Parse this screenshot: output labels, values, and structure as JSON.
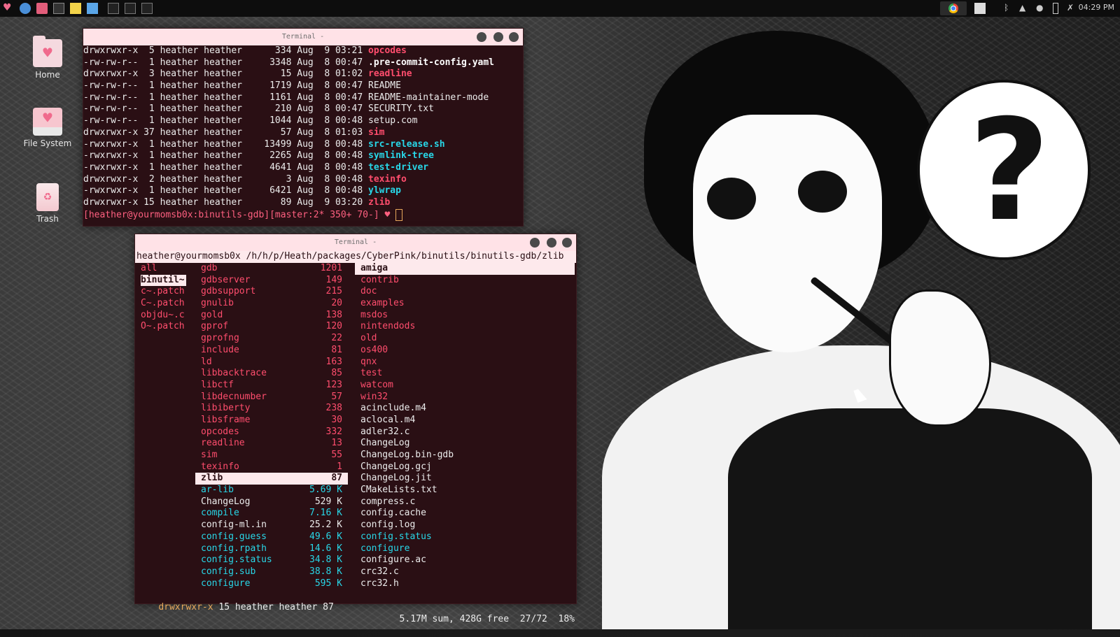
{
  "panel": {
    "clock": "04:29 PM"
  },
  "desktop": {
    "icons": [
      {
        "label": "Home"
      },
      {
        "label": "File System"
      },
      {
        "label": "Trash"
      }
    ]
  },
  "terminal1": {
    "title": "Terminal -",
    "lines": [
      {
        "perm": "drwxrwxr-x",
        "links": "5",
        "user": "heather",
        "group": "heather",
        "size": "334",
        "mon": "Aug",
        "day": "9",
        "time": "03:21",
        "name": "opcodes",
        "kind": "dir"
      },
      {
        "perm": "-rw-rw-r--",
        "links": "1",
        "user": "heather",
        "group": "heather",
        "size": "3348",
        "mon": "Aug",
        "day": "8",
        "time": "00:47",
        "name": ".pre-commit-config.yaml",
        "kind": "bold"
      },
      {
        "perm": "drwxrwxr-x",
        "links": "3",
        "user": "heather",
        "group": "heather",
        "size": "15",
        "mon": "Aug",
        "day": "8",
        "time": "01:02",
        "name": "readline",
        "kind": "dir"
      },
      {
        "perm": "-rw-rw-r--",
        "links": "1",
        "user": "heather",
        "group": "heather",
        "size": "1719",
        "mon": "Aug",
        "day": "8",
        "time": "00:47",
        "name": "README",
        "kind": "file"
      },
      {
        "perm": "-rw-rw-r--",
        "links": "1",
        "user": "heather",
        "group": "heather",
        "size": "1161",
        "mon": "Aug",
        "day": "8",
        "time": "00:47",
        "name": "README-maintainer-mode",
        "kind": "file"
      },
      {
        "perm": "-rw-rw-r--",
        "links": "1",
        "user": "heather",
        "group": "heather",
        "size": "210",
        "mon": "Aug",
        "day": "8",
        "time": "00:47",
        "name": "SECURITY.txt",
        "kind": "file"
      },
      {
        "perm": "-rw-rw-r--",
        "links": "1",
        "user": "heather",
        "group": "heather",
        "size": "1044",
        "mon": "Aug",
        "day": "8",
        "time": "00:48",
        "name": "setup.com",
        "kind": "file"
      },
      {
        "perm": "drwxrwxr-x",
        "links": "37",
        "user": "heather",
        "group": "heather",
        "size": "57",
        "mon": "Aug",
        "day": "8",
        "time": "01:03",
        "name": "sim",
        "kind": "dir"
      },
      {
        "perm": "-rwxrwxr-x",
        "links": "1",
        "user": "heather",
        "group": "heather",
        "size": "13499",
        "mon": "Aug",
        "day": "8",
        "time": "00:48",
        "name": "src-release.sh",
        "kind": "exe"
      },
      {
        "perm": "-rwxrwxr-x",
        "links": "1",
        "user": "heather",
        "group": "heather",
        "size": "2265",
        "mon": "Aug",
        "day": "8",
        "time": "00:48",
        "name": "symlink-tree",
        "kind": "exe"
      },
      {
        "perm": "-rwxrwxr-x",
        "links": "1",
        "user": "heather",
        "group": "heather",
        "size": "4641",
        "mon": "Aug",
        "day": "8",
        "time": "00:48",
        "name": "test-driver",
        "kind": "exe"
      },
      {
        "perm": "drwxrwxr-x",
        "links": "2",
        "user": "heather",
        "group": "heather",
        "size": "3",
        "mon": "Aug",
        "day": "8",
        "time": "00:48",
        "name": "texinfo",
        "kind": "dir"
      },
      {
        "perm": "-rwxrwxr-x",
        "links": "1",
        "user": "heather",
        "group": "heather",
        "size": "6421",
        "mon": "Aug",
        "day": "8",
        "time": "00:48",
        "name": "ylwrap",
        "kind": "exe"
      },
      {
        "perm": "drwxrwxr-x",
        "links": "15",
        "user": "heather",
        "group": "heather",
        "size": "89",
        "mon": "Aug",
        "day": "9",
        "time": "03:20",
        "name": "zlib",
        "kind": "dir"
      }
    ],
    "prompt": "[heather@yourmomsb0x:binutils-gdb][master:2* 350+ 70-]"
  },
  "terminal2": {
    "title": "Terminal -",
    "path": "heather@yourmomsb0x /h/h/p/Heath/packages/CyberPink/binutils/binutils-gdb/zlib",
    "col1": [
      {
        "name": "all",
        "sel": false
      },
      {
        "name": "binutil~",
        "sel": true
      },
      {
        "name": "c~.patch",
        "sel": false
      },
      {
        "name": "C~.patch",
        "sel": false
      },
      {
        "name": "objdu~.c",
        "sel": false
      },
      {
        "name": "O~.patch",
        "sel": false
      }
    ],
    "col2": [
      {
        "name": "gdb",
        "num": "1201",
        "kind": "dir"
      },
      {
        "name": "gdbserver",
        "num": "149",
        "kind": "dir"
      },
      {
        "name": "gdbsupport",
        "num": "215",
        "kind": "dir"
      },
      {
        "name": "gnulib",
        "num": "20",
        "kind": "dir"
      },
      {
        "name": "gold",
        "num": "138",
        "kind": "dir"
      },
      {
        "name": "gprof",
        "num": "120",
        "kind": "dir"
      },
      {
        "name": "gprofng",
        "num": "22",
        "kind": "dir"
      },
      {
        "name": "include",
        "num": "81",
        "kind": "dir"
      },
      {
        "name": "ld",
        "num": "163",
        "kind": "dir"
      },
      {
        "name": "libbacktrace",
        "num": "85",
        "kind": "dir"
      },
      {
        "name": "libctf",
        "num": "123",
        "kind": "dir"
      },
      {
        "name": "libdecnumber",
        "num": "57",
        "kind": "dir"
      },
      {
        "name": "libiberty",
        "num": "238",
        "kind": "dir"
      },
      {
        "name": "libsframe",
        "num": "30",
        "kind": "dir"
      },
      {
        "name": "opcodes",
        "num": "332",
        "kind": "dir"
      },
      {
        "name": "readline",
        "num": "13",
        "kind": "dir"
      },
      {
        "name": "sim",
        "num": "55",
        "kind": "dir"
      },
      {
        "name": "texinfo",
        "num": "1",
        "kind": "dir"
      },
      {
        "name": "zlib",
        "num": "87",
        "kind": "sel"
      },
      {
        "name": "ar-lib",
        "num": "5.69 K",
        "kind": "exe"
      },
      {
        "name": "ChangeLog",
        "num": "529 K",
        "kind": "file"
      },
      {
        "name": "compile",
        "num": "7.16 K",
        "kind": "exe"
      },
      {
        "name": "config-ml.in",
        "num": "25.2 K",
        "kind": "file"
      },
      {
        "name": "config.guess",
        "num": "49.6 K",
        "kind": "exe"
      },
      {
        "name": "config.rpath",
        "num": "14.6 K",
        "kind": "exe"
      },
      {
        "name": "config.status",
        "num": "34.8 K",
        "kind": "exe"
      },
      {
        "name": "config.sub",
        "num": "38.8 K",
        "kind": "exe"
      },
      {
        "name": "configure",
        "num": "595 K",
        "kind": "exe"
      }
    ],
    "col3": [
      {
        "name": "amiga",
        "kind": "sel"
      },
      {
        "name": "contrib",
        "kind": "dir"
      },
      {
        "name": "doc",
        "kind": "dir"
      },
      {
        "name": "examples",
        "kind": "dir"
      },
      {
        "name": "msdos",
        "kind": "dir"
      },
      {
        "name": "nintendods",
        "kind": "dir"
      },
      {
        "name": "old",
        "kind": "dir"
      },
      {
        "name": "os400",
        "kind": "dir"
      },
      {
        "name": "qnx",
        "kind": "dir"
      },
      {
        "name": "test",
        "kind": "dir"
      },
      {
        "name": "watcom",
        "kind": "dir"
      },
      {
        "name": "win32",
        "kind": "dir"
      },
      {
        "name": "acinclude.m4",
        "kind": "file"
      },
      {
        "name": "aclocal.m4",
        "kind": "file"
      },
      {
        "name": "adler32.c",
        "kind": "file"
      },
      {
        "name": "ChangeLog",
        "kind": "file"
      },
      {
        "name": "ChangeLog.bin-gdb",
        "kind": "file"
      },
      {
        "name": "ChangeLog.gcj",
        "kind": "file"
      },
      {
        "name": "ChangeLog.jit",
        "kind": "file"
      },
      {
        "name": "CMakeLists.txt",
        "kind": "file"
      },
      {
        "name": "compress.c",
        "kind": "file"
      },
      {
        "name": "config.cache",
        "kind": "file"
      },
      {
        "name": "config.log",
        "kind": "file"
      },
      {
        "name": "config.status",
        "kind": "exe"
      },
      {
        "name": "configure",
        "kind": "exe"
      },
      {
        "name": "configure.ac",
        "kind": "file"
      },
      {
        "name": "crc32.c",
        "kind": "file"
      },
      {
        "name": "crc32.h",
        "kind": "file"
      }
    ],
    "status_perm": "drwxrwxr-x",
    "status_info": "15 heather heather 87",
    "status_right": "5.17M sum, 428G free  27/72  18%"
  },
  "art": {
    "bubble_text": "?"
  }
}
